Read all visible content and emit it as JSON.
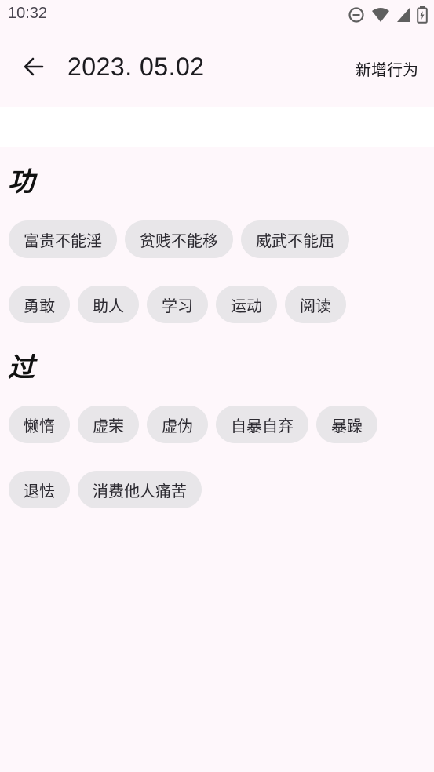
{
  "status_bar": {
    "time": "10:32",
    "icons": [
      "do-not-disturb-icon",
      "wifi-icon",
      "cellular-signal-icon",
      "battery-icon"
    ]
  },
  "app_bar": {
    "back_icon": "arrow-back-icon",
    "title": "2023. 05.02",
    "action_label": "新增行为"
  },
  "sections": [
    {
      "heading": "功",
      "rows": [
        [
          "富贵不能淫",
          "贫贱不能移",
          "威武不能屈"
        ],
        [
          "勇敢",
          "助人",
          "学习",
          "运动",
          "阅读"
        ]
      ]
    },
    {
      "heading": "过",
      "rows": [
        [
          "懒惰",
          "虚荣",
          "虚伪",
          "自暴自弃",
          "暴躁"
        ],
        [
          "退怯",
          "消费他人痛苦"
        ]
      ]
    }
  ],
  "colors": {
    "background": "#fef7fb",
    "chip_background": "#e8e6e9",
    "text": "#1c1b1f"
  }
}
